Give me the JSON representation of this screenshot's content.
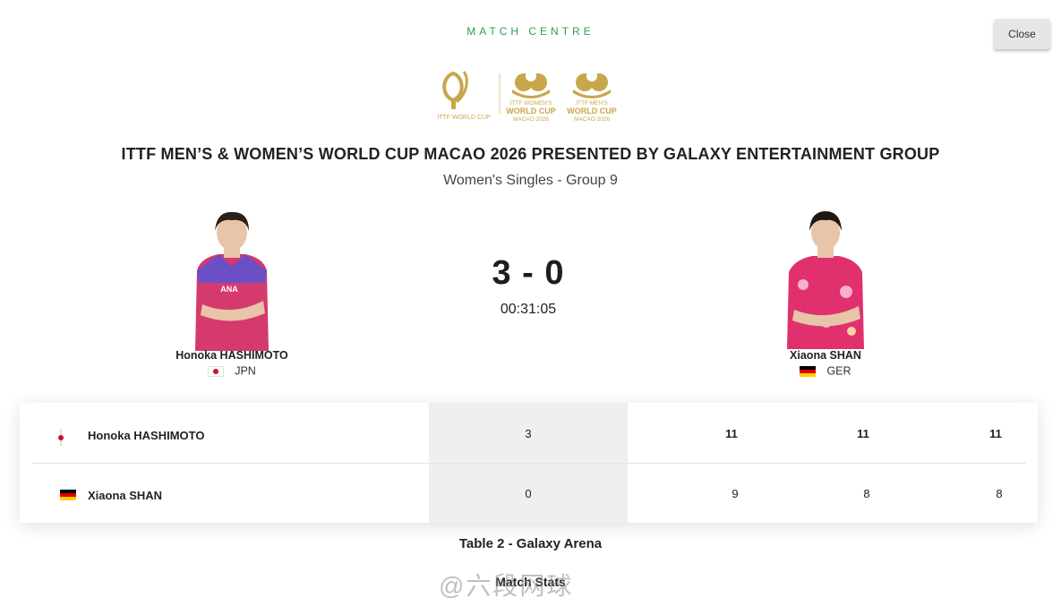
{
  "header": {
    "label": "MATCH CENTRE",
    "close_label": "Close"
  },
  "logos": {
    "ittf_text": "ITTF WORLD CUP",
    "womens_line1": "ITTF WOMEN'S",
    "womens_line2": "WORLD CUP",
    "womens_line3": "MACAO 2026",
    "mens_line1": "ITTF MEN'S",
    "mens_line2": "WORLD CUP",
    "mens_line3": "MACAO 2026",
    "gold_color": "#c9a64a"
  },
  "event": {
    "title": "ITTF MEN’S & WOMEN’S WORLD CUP MACAO 2026 PRESENTED BY GALAXY ENTERTAINMENT GROUP",
    "subtitle": "Women's Singles - Group 9"
  },
  "players": [
    {
      "name": "Honoka HASHIMOTO",
      "country": "JPN",
      "flag": "flag-japan",
      "jersey_color": "#d43a6b"
    },
    {
      "name": "Xiaona SHAN",
      "country": "GER",
      "flag": "flag-germany",
      "jersey_color": "#e0306e"
    }
  ],
  "match": {
    "score": "3 - 0",
    "duration": "00:31:05"
  },
  "scoreboard": {
    "rows": [
      {
        "name": "Honoka HASHIMOTO",
        "games": "3",
        "sets": [
          "11",
          "11",
          "11"
        ]
      },
      {
        "name": "Xiaona SHAN",
        "games": "0",
        "sets": [
          "9",
          "8",
          "8"
        ]
      }
    ]
  },
  "venue": "Table 2 - Galaxy Arena",
  "stats_title": "Match Stats",
  "watermark": "@六段网球"
}
